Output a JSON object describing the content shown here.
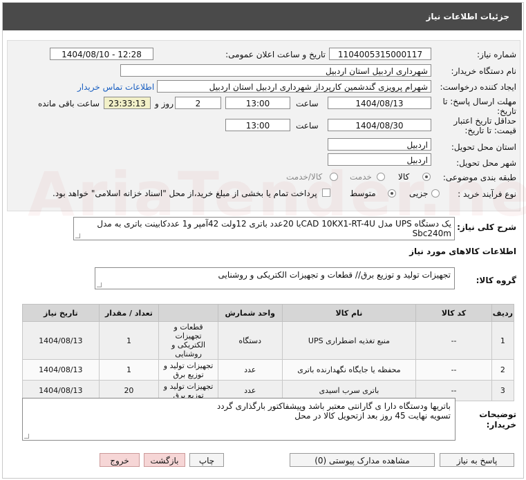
{
  "window_title": "جزئیات اطلاعات نیاز",
  "fields": {
    "need_number_label": "شماره نیاز:",
    "need_number": "1104005315000117",
    "announce_label": "تاریخ و ساعت اعلان عمومی:",
    "announce_value": "1404/08/10 - 12:28",
    "buyer_org_label": "نام دستگاه خریدار:",
    "buyer_org": "شهرداری اردبیل استان اردبیل",
    "creator_label": "ایجاد کننده درخواست:",
    "creator": "شهرام پرویزی گندشمین کارپرداز شهرداری اردبیل استان اردبیل",
    "contact_link": "اطلاعات تماس خریدار",
    "deadline_label_1": "مهلت ارسال پاسخ: تا",
    "deadline_label_2": "تاریخ:",
    "deadline_date": "1404/08/13",
    "time_label": "ساعت",
    "deadline_time": "13:00",
    "days_value": "2",
    "days_label": "روز و",
    "remaining_time": "23:33:13",
    "remaining_label": "ساعت باقی مانده",
    "validity_label_1": "حداقل تاریخ اعتبار",
    "validity_label_2": "قیمت: تا تاریخ:",
    "validity_date": "1404/08/30",
    "validity_time_label": "ساعت",
    "validity_time": "13:00",
    "province_label": "استان محل تحویل:",
    "province": "اردبیل",
    "city_label": "شهر محل تحویل:",
    "city": "اردبیل",
    "category_label": "طبقه بندی موضوعی:",
    "category_options": [
      "کالا",
      "خدمت",
      "کالا/خدمت"
    ],
    "process_label": "نوع فرآیند خرید :",
    "process_options": [
      "جزیی",
      "متوسط"
    ],
    "payment_text": "پرداخت تمام یا بخشی از مبلغ خرید،از محل \"اسناد خزانه اسلامی\" خواهد بود."
  },
  "summary": {
    "label": "شرح کلی نیاز:",
    "text": "یک دستگاه  UPS  مدل  CAD 10KX1-RT-4Uبا 20عدد باتری 12ولت 42آمپر و1 عددکابینت باتری به مدل Sbc240m"
  },
  "goods_info_title": "اطلاعات کالاهای مورد نیاز",
  "goods_group": {
    "label": "گروه کالا:",
    "value": "تجهیزات تولید و توزیع برق// قطعات و تجهیزات الکتریکی و روشنایی"
  },
  "table": {
    "headers": [
      "ردیف",
      "کد کالا",
      "نام کالا",
      "واحد شمارش",
      "تعداد / مقدار",
      "تاریخ نیاز"
    ],
    "rows": [
      {
        "row": "1",
        "code": "--",
        "name": "منبع تغذیه اضطراری UPS",
        "unit": "دستگاه",
        "qty": "1",
        "group": "قطعات و تجهیزات الکتریکی و روشنایی",
        "date": "1404/08/13"
      },
      {
        "row": "2",
        "code": "--",
        "name": "محفظه یا جایگاه نگهدارنده باتری",
        "unit": "عدد",
        "qty": "1",
        "group": "تجهیزات تولید و توزیع برق",
        "date": "1404/08/13"
      },
      {
        "row": "3",
        "code": "--",
        "name": "باتری سرب اسیدی",
        "unit": "عدد",
        "qty": "20",
        "group": "تجهیزات تولید و توزیع برق",
        "date": "1404/08/13"
      }
    ]
  },
  "buyer_notes": {
    "label_1": "توضیحات",
    "label_2": "خریدار:",
    "line1": "باتریها ودستگاه دارا ی گارانتی معتبر باشد وپیشفاکتور بارگذاری گردد",
    "line2": "تسویه نهایت 45 روز بعد ازتحویل کالا در محل"
  },
  "buttons": {
    "reply": "پاسخ به نیاز",
    "view_docs": "مشاهده مدارک پیوستی (0)",
    "print": "چاپ",
    "back": "بازگشت",
    "exit": "خروج"
  },
  "watermark": "AriaTender.neT"
}
